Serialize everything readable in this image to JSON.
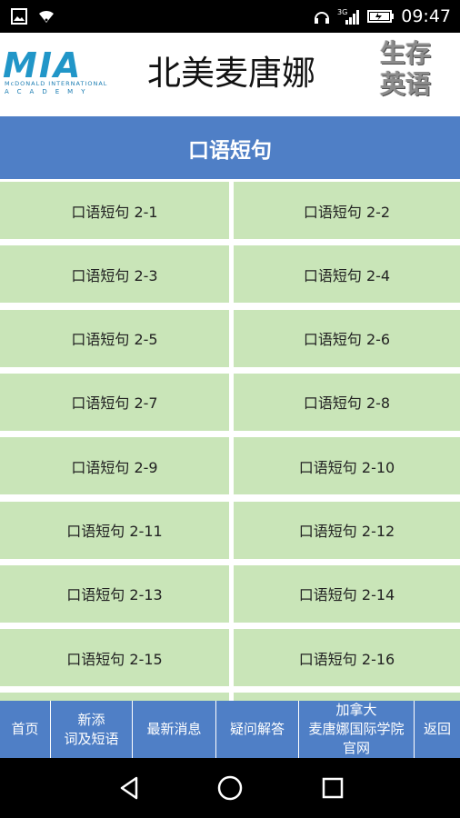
{
  "status_bar": {
    "time": "09:47",
    "network": "3G",
    "icons": [
      "image-icon",
      "wifi-icon",
      "headphones-icon",
      "signal-icon",
      "battery-icon"
    ]
  },
  "header": {
    "logo": {
      "text": "MIA",
      "subtitle_line1": "McDONALD INTERNATIONAL",
      "subtitle_line2": "ACADEMY"
    },
    "title": "北美麦唐娜",
    "badge_line1": "生存",
    "badge_line2": "英语"
  },
  "section": {
    "title": "口语短句"
  },
  "grid": {
    "items": [
      "口语短句 2-1",
      "口语短句 2-2",
      "口语短句 2-3",
      "口语短句 2-4",
      "口语短句 2-5",
      "口语短句 2-6",
      "口语短句 2-7",
      "口语短句 2-8",
      "口语短句 2-9",
      "口语短句 2-10",
      "口语短句 2-11",
      "口语短句 2-12",
      "口语短句 2-13",
      "口语短句 2-14",
      "口语短句 2-15",
      "口语短句 2-16",
      "",
      ""
    ]
  },
  "bottom_nav": {
    "items": [
      {
        "lines": [
          "首页"
        ]
      },
      {
        "lines": [
          "新添",
          "词及短语"
        ]
      },
      {
        "lines": [
          "最新消息"
        ]
      },
      {
        "lines": [
          "疑问解答"
        ]
      },
      {
        "lines": [
          "加拿大",
          "麦唐娜国际学院",
          "官网"
        ]
      },
      {
        "lines": [
          "返回"
        ]
      }
    ]
  },
  "android_nav": {
    "icons": [
      "back-icon",
      "home-icon",
      "recents-icon"
    ]
  },
  "colors": {
    "accent_blue": "#4f7fc6",
    "cell_green": "#c9e5b8",
    "logo_blue": "#2196c8"
  }
}
